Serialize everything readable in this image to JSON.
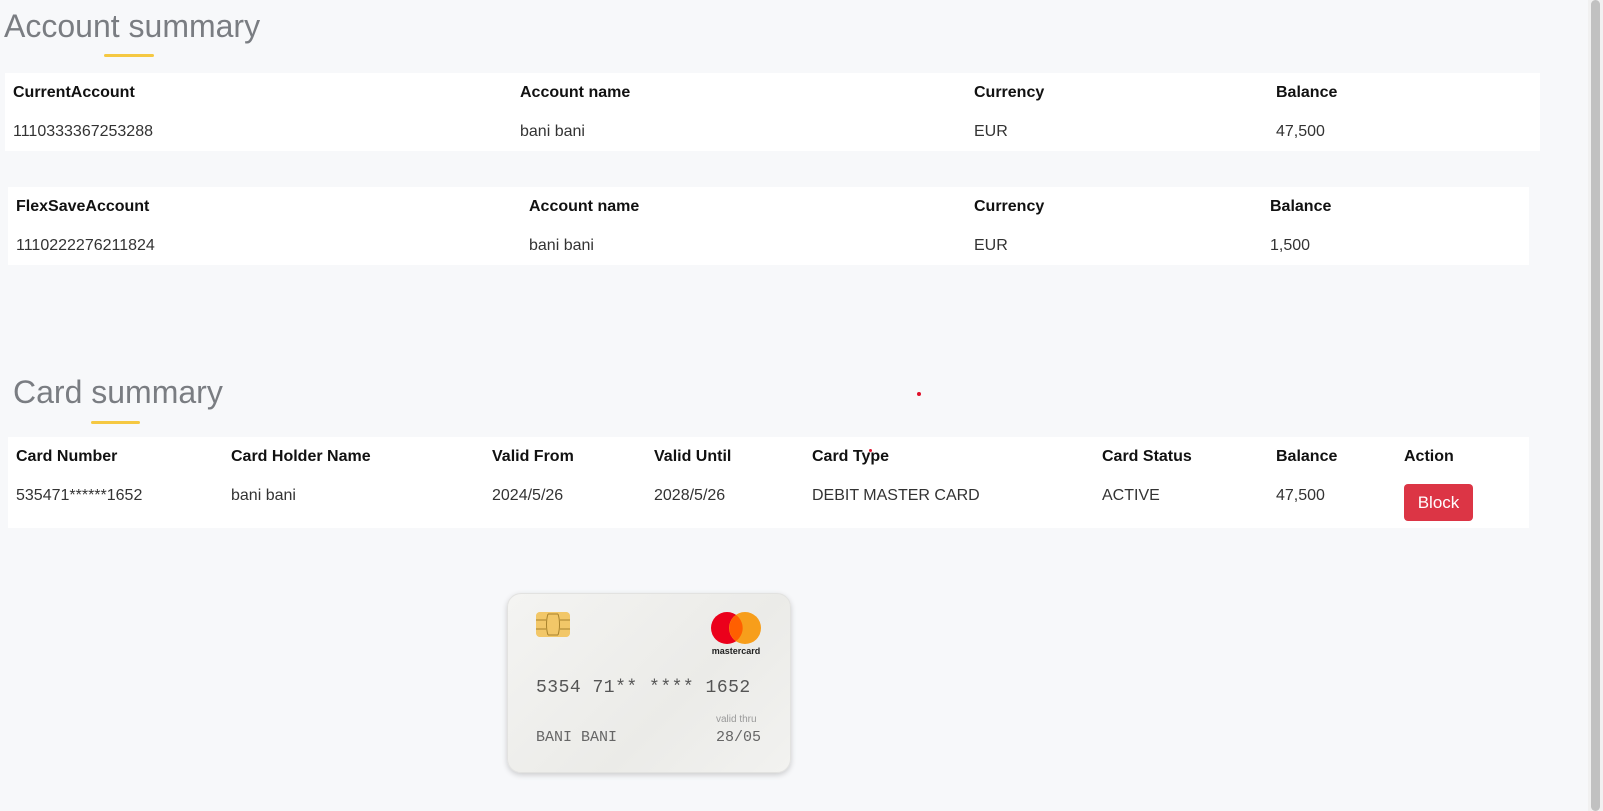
{
  "account_summary": {
    "title": "Account summary",
    "current_account": {
      "headers": [
        "CurrentAccount",
        "Account name",
        "Currency",
        "Balance"
      ],
      "values": [
        "1110333367253288",
        "bani bani",
        "EUR",
        "47,500"
      ]
    },
    "flexsave_account": {
      "headers": [
        "FlexSaveAccount",
        "Account name",
        "Currency",
        "Balance"
      ],
      "values": [
        "1110222276211824",
        "bani bani",
        "EUR",
        "1,500"
      ]
    }
  },
  "card_summary": {
    "title": "Card summary",
    "headers": [
      "Card Number",
      "Card Holder Name",
      "Valid From",
      "Valid Until",
      "Card Type",
      "Card Status",
      "Balance",
      "Action"
    ],
    "row": [
      "535471******1652",
      "bani bani",
      "2024/5/26",
      "2028/5/26",
      "DEBIT MASTER CARD",
      "ACTIVE",
      "47,500"
    ],
    "action_label": "Block"
  },
  "card_visual": {
    "number": "5354 71** **** 1652",
    "holder": "BANI BANI",
    "valid_thru_label": "valid thru",
    "expiry": "28/05",
    "brand": "mastercard"
  },
  "colors": {
    "accent_underline": "#f5c842",
    "block_button": "#dc3545",
    "mc_red": "#eb001b",
    "mc_orange": "#f79e1b"
  }
}
